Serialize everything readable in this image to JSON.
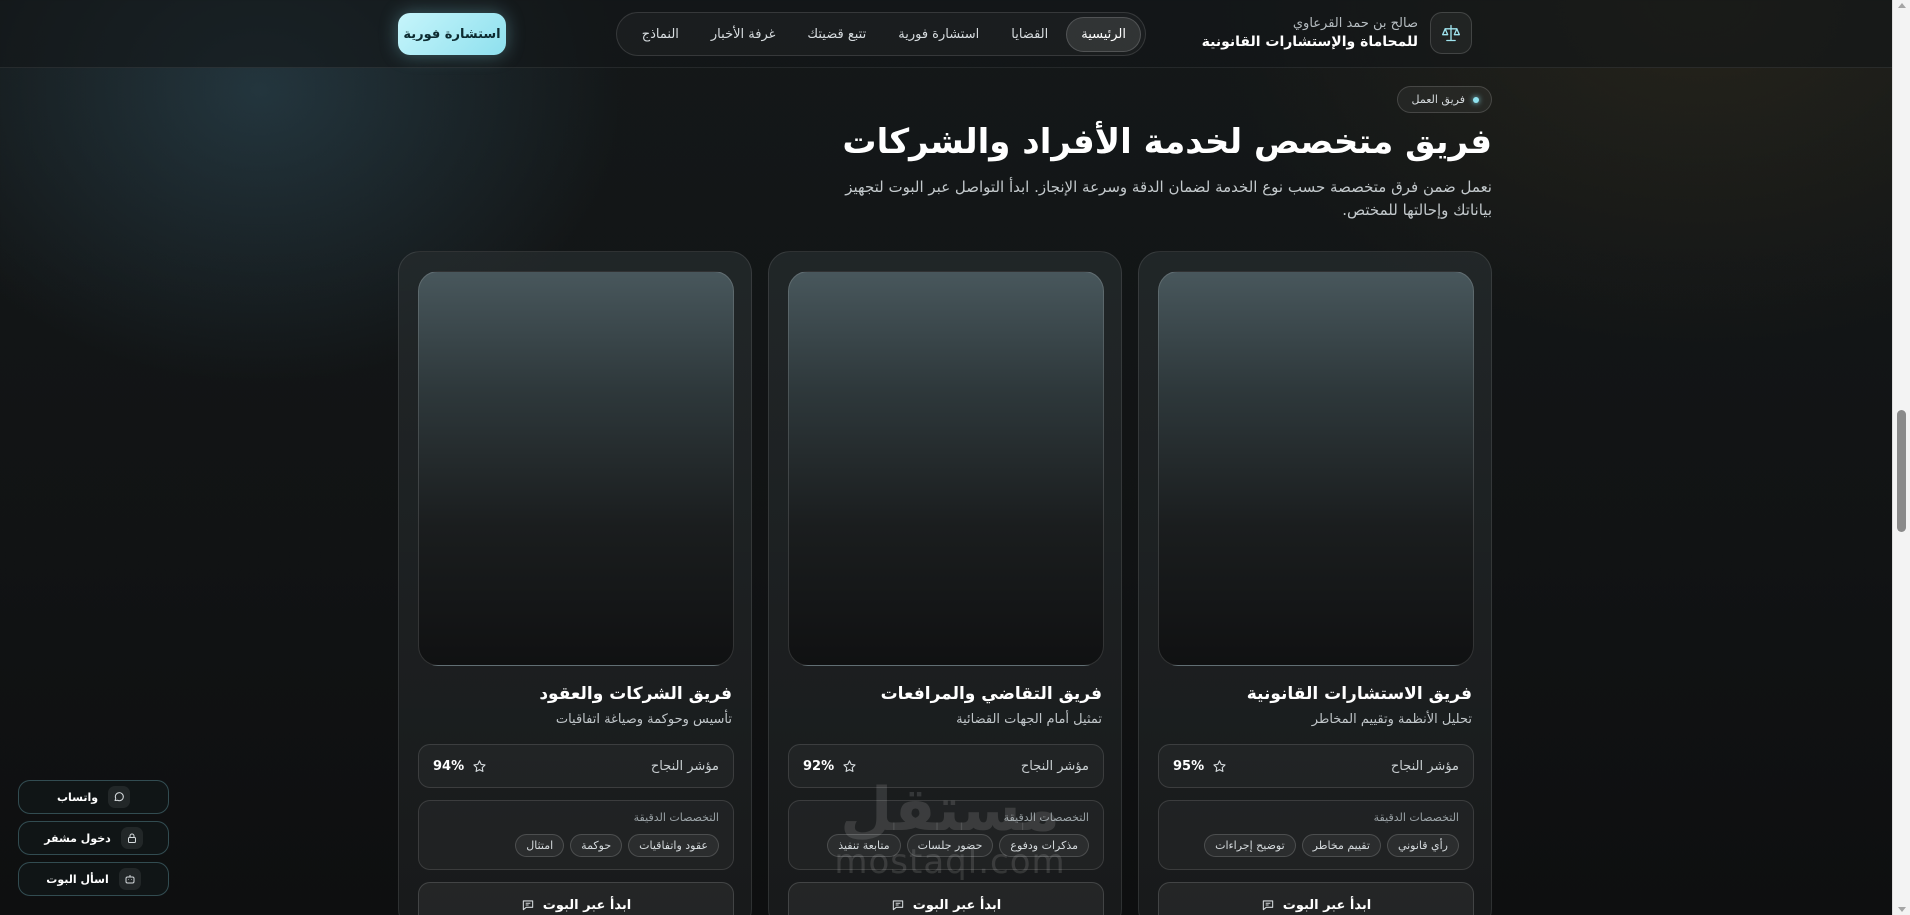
{
  "brand": {
    "name_small": "صالح بن حمد القرعاوي",
    "name_main": "للمحاماة والإستشارات القانونية",
    "logo_icon": "scales-icon"
  },
  "nav": {
    "items": [
      "الرئيسية",
      "القضايا",
      "استشارة فورية",
      "تتبع قضيتك",
      "غرفة الأخبار",
      "النماذج"
    ],
    "active": "الرئيسية"
  },
  "header_cta": "استشارة فورية",
  "section": {
    "badge": "فريق العمل",
    "title": "فريق متخصص لخدمة الأفراد والشركات",
    "description": "نعمل ضمن فرق متخصصة حسب نوع الخدمة لضمان الدقة وسرعة الإنجاز. ابدأ التواصل عبر البوت لتجهيز بياناتك وإحالتها للمختص."
  },
  "cards": [
    {
      "title": "فريق الاستشارات القانونية",
      "subtitle": "تحليل الأنظمة وتقييم المخاطر",
      "stat_label": "مؤشر النجاح",
      "stat_value": "95%",
      "specs_title": "التخصصات الدقيقة",
      "chips": [
        "رأي قانوني",
        "تقييم مخاطر",
        "توضيح إجراءات"
      ],
      "button": "ابدأ عبر البوت"
    },
    {
      "title": "فريق التقاضي والمرافعات",
      "subtitle": "تمثيل أمام الجهات القضائية",
      "stat_label": "مؤشر النجاح",
      "stat_value": "92%",
      "specs_title": "التخصصات الدقيقة",
      "chips": [
        "مذكرات ودفوع",
        "حضور جلسات",
        "متابعة تنفيذ"
      ],
      "button": "ابدأ عبر البوت"
    },
    {
      "title": "فريق الشركات والعقود",
      "subtitle": "تأسيس وحوكمة وصياغة اتفاقيات",
      "stat_label": "مؤشر النجاح",
      "stat_value": "94%",
      "specs_title": "التخصصات الدقيقة",
      "chips": [
        "عقود واتفاقيات",
        "حوكمة",
        "امتثال"
      ],
      "button": "ابدأ عبر البوت"
    }
  ],
  "floating": {
    "whatsapp": "واتساب",
    "admin_login": "دخول مشفر",
    "ask_bot": "اسأل البوت"
  },
  "watermark": {
    "ar": "مستقل",
    "en": "mostaql.com"
  },
  "colors": {
    "accent": "#8ee0ee",
    "background": "#121516"
  }
}
